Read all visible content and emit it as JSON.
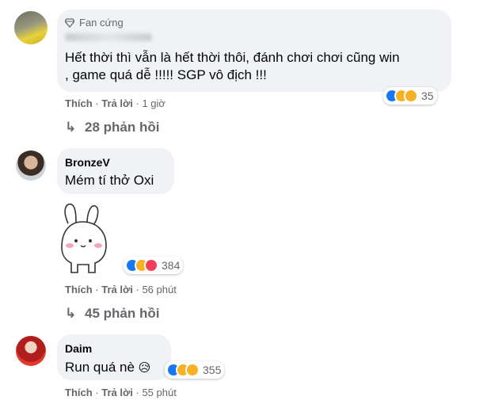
{
  "comments": [
    {
      "badge": "Fan cứng",
      "text_line1": "Hết thời thì vẫn là hết thời thôi, đánh chơi chơi cũng win",
      "text_line2": ", game quá dễ !!!!! SGP vô địch !!!",
      "like": "Thích",
      "reply": "Trả lời",
      "time": "1 giờ",
      "reactions": "35",
      "replies": "28 phản hồi"
    },
    {
      "author": "BronzeV",
      "text": "Mém tí thở Oxi",
      "like": "Thích",
      "reply": "Trả lời",
      "time": "56 phút",
      "reactions": "384",
      "replies": "45 phản hồi"
    },
    {
      "author": "Daim",
      "text": "Run quá nè",
      "emoji": "😥",
      "like": "Thích",
      "reply": "Trả lời",
      "time": "55 phút",
      "reactions": "355"
    }
  ],
  "separator": "·",
  "reply_arrow": "↳",
  "colors": {
    "like": "#1877f2",
    "haha": "#f7b125",
    "love": "#f33e58",
    "bubble": "#f0f2f5",
    "meta": "#65676b"
  }
}
